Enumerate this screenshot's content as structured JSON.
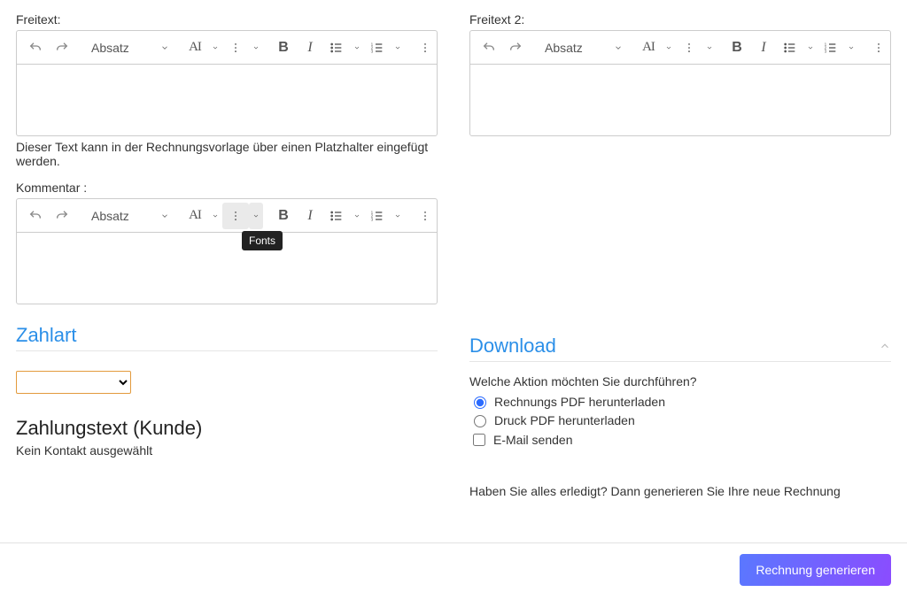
{
  "fields": {
    "freitext_label": "Freitext:",
    "freitext2_label": "Freitext 2:",
    "kommentar_label": "Kommentar :",
    "freitext_help": "Dieser Text kann in der Rechnungsvorlage über einen Platzhalter eingefügt werden."
  },
  "toolbar": {
    "paragraph": "Absatz",
    "fonts_tooltip": "Fonts"
  },
  "sections": {
    "zahlart": "Zahlart",
    "download": "Download",
    "zahlungstext": "Zahlungstext (Kunde)",
    "no_contact": "Kein Kontakt ausgewählt"
  },
  "download": {
    "question": "Welche Aktion möchten Sie durchführen?",
    "opt_pdf": "Rechnungs PDF herunterladen",
    "opt_druck": "Druck PDF herunterladen",
    "opt_email": "E-Mail senden",
    "generate_hint": "Haben Sie alles erledigt? Dann generieren Sie Ihre neue Rechnung"
  },
  "footer": {
    "generate_button": "Rechnung generieren"
  }
}
